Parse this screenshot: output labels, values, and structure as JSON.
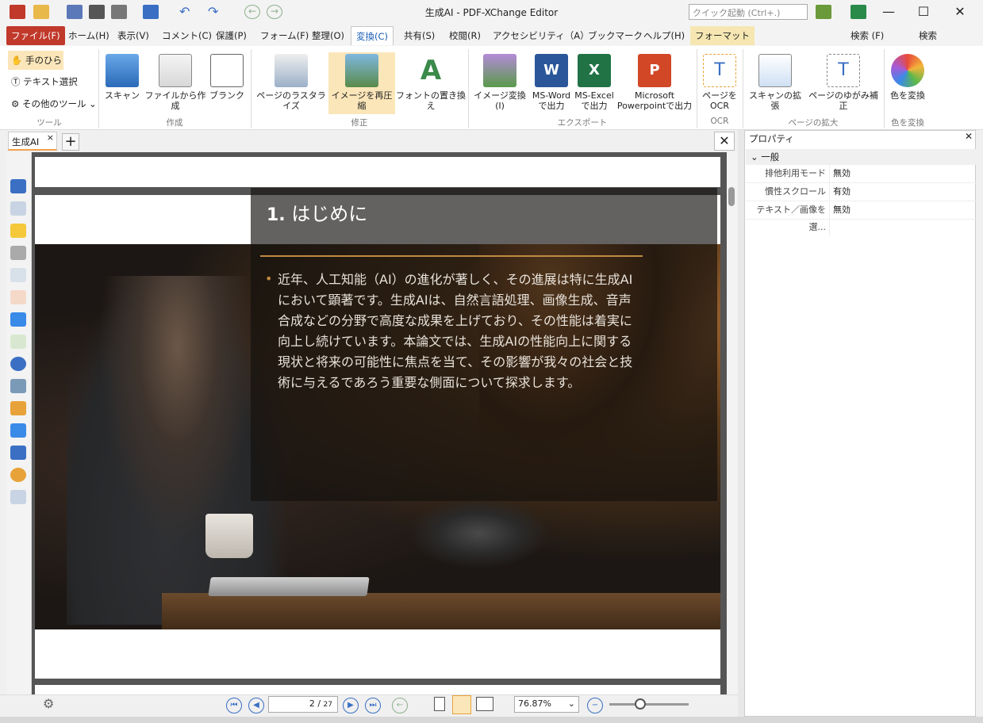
{
  "window": {
    "title": "生成AI - PDF-XChange Editor",
    "minimize": "—",
    "maximize": "☐",
    "close": "✕"
  },
  "quick_launch": {
    "placeholder": "クイック起動 (Ctrl+.)"
  },
  "menu": {
    "items": [
      "ファイル(F)",
      "ホーム(H)",
      "表示(V)",
      "コメント(C)",
      "保護(P)",
      "フォーム(F)",
      "整理(O)",
      "変換(C)",
      "共有(S)",
      "校閲(R)",
      "アクセシビリティ（A）",
      "ブックマーク",
      "ヘルプ(H)",
      "フォーマット"
    ],
    "search1": "検索 (F)",
    "search2": "検索"
  },
  "ribbon": {
    "tools": [
      "手のひら",
      "テキスト選択",
      "その他のツール"
    ],
    "buttons": [
      "スキャン",
      "ファイルから作成",
      "ブランク",
      "ページのラスタライズ",
      "イメージを再圧縮",
      "フォントの置き換え",
      "イメージ変換(I)",
      "MS-Word\nで出力",
      "MS-Excel\nで出力",
      "Microsoft\nPowerpointで出力",
      "ページを\nOCR",
      "スキャンの拡張",
      "ページのゆがみ補正",
      "色を変換"
    ],
    "groups": [
      "ツール",
      "作成",
      "修正",
      "エクスポート",
      "OCR",
      "ページの拡大",
      "色を変換"
    ]
  },
  "doc_tab": {
    "label": "生成AI",
    "close": "×",
    "add": "+"
  },
  "slide": {
    "number": "1.",
    "heading": "はじめに",
    "bullet": "•",
    "body": "近年、人工知能（AI）の進化が著しく、その進展は特に生成AIにおいて顕著です。生成AIは、自然言語処理、画像生成、音声合成などの分野で高度な成果を上げており、その性能は着実に向上し続けています。本論文では、生成AIの性能向上に関する現状と将来の可能性に焦点を当て、その影響が我々の社会と技術に与えるであろう重要な側面について探求します。"
  },
  "properties": {
    "title": "プロパティ",
    "section": "一般",
    "rows": [
      {
        "key": "排他利用モード",
        "value": "無効"
      },
      {
        "key": "慣性スクロール",
        "value": "有効"
      },
      {
        "key": "テキスト／画像を選...",
        "value": "無効"
      }
    ]
  },
  "status": {
    "page_current": "2",
    "page_total": "27",
    "zoom": "76.87%"
  },
  "colors": {
    "accent": "#c08a42",
    "file_menu": "#c0392b",
    "selected_tab": "#1a5fb4"
  }
}
